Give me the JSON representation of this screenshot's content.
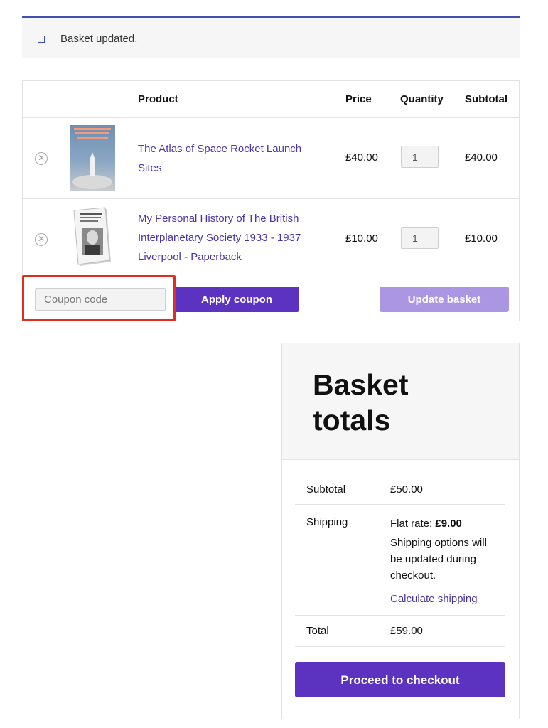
{
  "notice": {
    "message": "Basket updated.",
    "icon": "square-outline-icon",
    "accent": "#3f51b5"
  },
  "cart": {
    "headers": {
      "product": "Product",
      "price": "Price",
      "quantity": "Quantity",
      "subtotal": "Subtotal"
    },
    "items": [
      {
        "name": "The Atlas of Space Rocket Launch Sites",
        "price": "£40.00",
        "quantity": "1",
        "subtotal": "£40.00",
        "cover_title": "THE ATLAS OF SPACE ROCKET LAUNCH SITES"
      },
      {
        "name": "My Personal History of The British Interplanetary Society 1933 - 1937 Liverpool - Paperback",
        "price": "£10.00",
        "quantity": "1",
        "subtotal": "£10.00",
        "cover_title": "My Personal History of The British Interplanetary Society"
      }
    ],
    "coupon_placeholder": "Coupon code",
    "apply_coupon_label": "Apply coupon",
    "update_basket_label": "Update basket"
  },
  "totals": {
    "title": "Basket totals",
    "subtotal_label": "Subtotal",
    "subtotal_value": "£50.00",
    "shipping_label": "Shipping",
    "shipping_rate_prefix": "Flat rate: ",
    "shipping_rate_value": "£9.00",
    "shipping_note": "Shipping options will be updated during checkout.",
    "calculate_shipping": "Calculate shipping",
    "total_label": "Total",
    "total_value": "£59.00",
    "checkout_label": "Proceed to checkout"
  },
  "colors": {
    "primary": "#5b33c0",
    "primary_disabled": "#aa96e2",
    "link": "#4a35a5",
    "highlight": "#e12d1f"
  }
}
